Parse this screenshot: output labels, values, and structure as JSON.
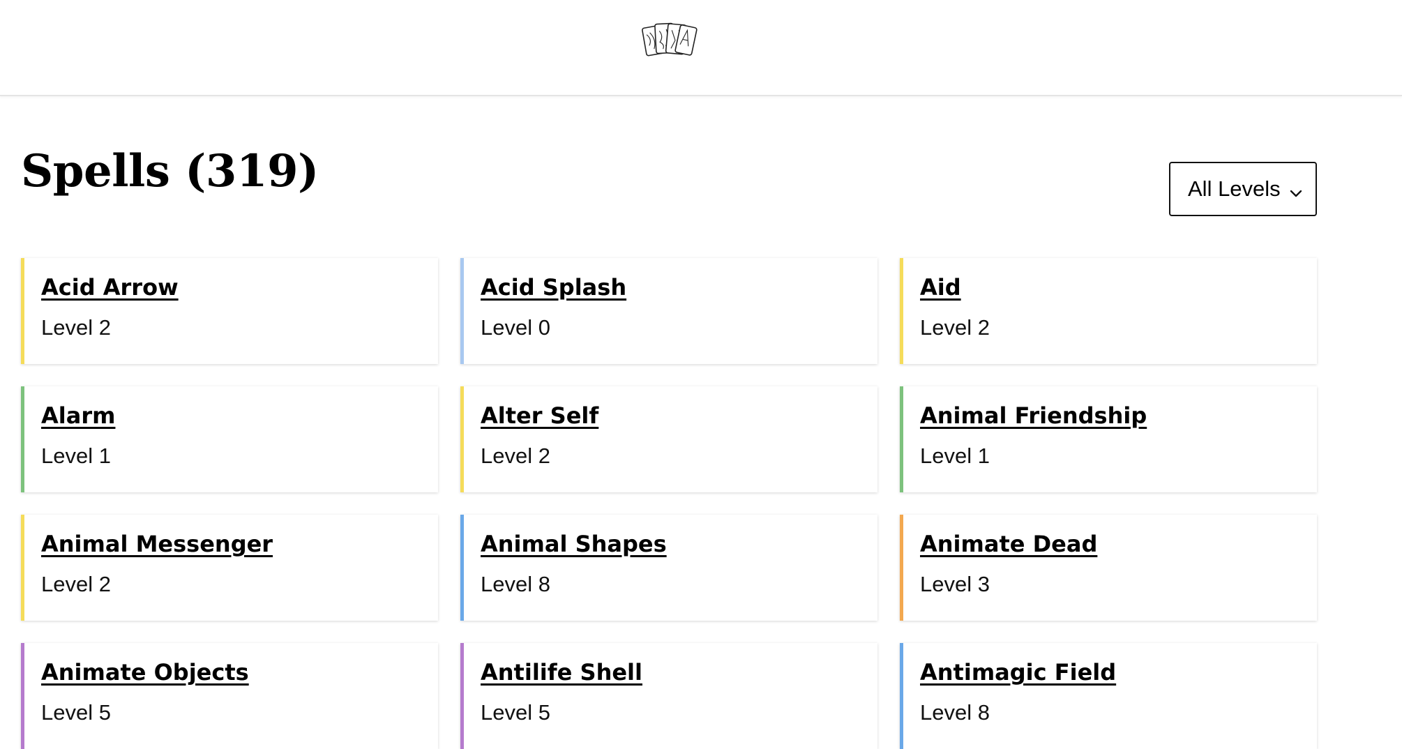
{
  "header": {
    "logo_icon": "playing-cards-icon"
  },
  "main": {
    "title": "Spells (319)",
    "level_filter": {
      "selected": "All Levels",
      "icon": "chevron-down-icon"
    }
  },
  "level_colors": {
    "0": "#a8c8f0",
    "1": "#7dc27d",
    "2": "#f5dc5a",
    "3": "#f3a84f",
    "5": "#b57bcd",
    "8": "#6aa8e8"
  },
  "spells": [
    {
      "name": "Acid Arrow",
      "level": "Level 2",
      "color": "#f5dc5a"
    },
    {
      "name": "Acid Splash",
      "level": "Level 0",
      "color": "#a8c8f0"
    },
    {
      "name": "Aid",
      "level": "Level 2",
      "color": "#f5dc5a"
    },
    {
      "name": "Alarm",
      "level": "Level 1",
      "color": "#7dc27d"
    },
    {
      "name": "Alter Self",
      "level": "Level 2",
      "color": "#f5dc5a"
    },
    {
      "name": "Animal Friendship",
      "level": "Level 1",
      "color": "#7dc27d"
    },
    {
      "name": "Animal Messenger",
      "level": "Level 2",
      "color": "#f5dc5a"
    },
    {
      "name": "Animal Shapes",
      "level": "Level 8",
      "color": "#6aa8e8"
    },
    {
      "name": "Animate Dead",
      "level": "Level 3",
      "color": "#f3a84f"
    },
    {
      "name": "Animate Objects",
      "level": "Level 5",
      "color": "#b57bcd"
    },
    {
      "name": "Antilife Shell",
      "level": "Level 5",
      "color": "#b57bcd"
    },
    {
      "name": "Antimagic Field",
      "level": "Level 8",
      "color": "#6aa8e8"
    }
  ]
}
